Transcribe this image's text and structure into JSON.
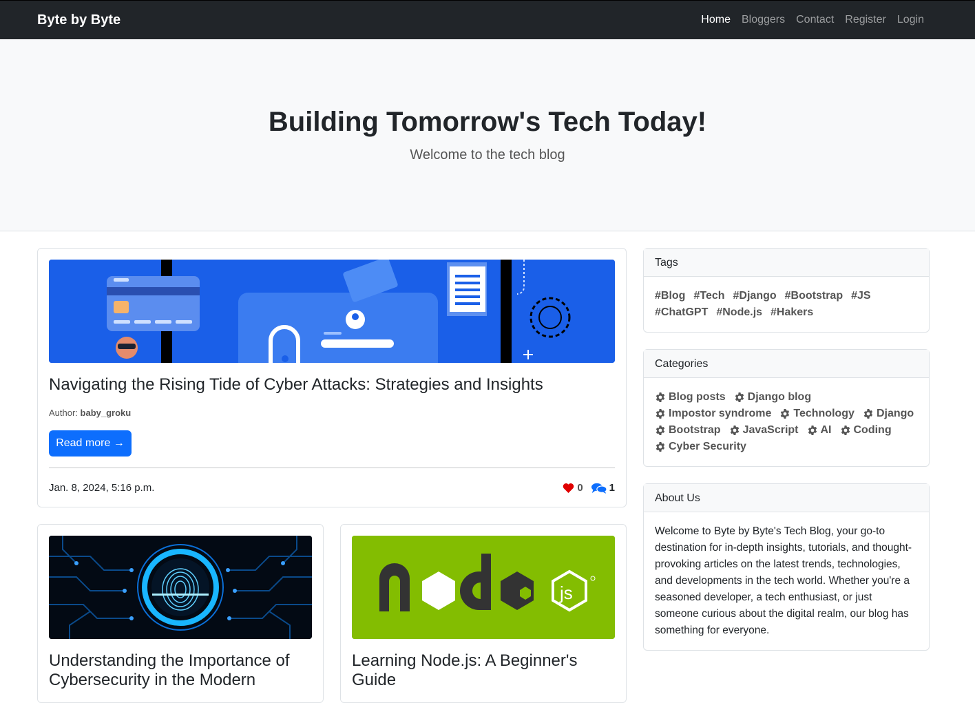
{
  "nav": {
    "brand": "Byte by Byte",
    "links": [
      "Home",
      "Bloggers",
      "Contact",
      "Register",
      "Login"
    ],
    "active": "Home"
  },
  "hero": {
    "title": "Building Tomorrow's Tech Today!",
    "subtitle": "Welcome to the tech blog"
  },
  "featured": {
    "title": "Navigating the Rising Tide of Cyber Attacks: Strategies and Insights",
    "author_label": "Author:",
    "author": "baby_groku",
    "read_more": "Read more →",
    "date": "Jan. 8, 2024, 5:16 p.m.",
    "likes": "0",
    "comments": "1"
  },
  "posts": [
    {
      "title": "Understanding the Importance of Cybersecurity in the Modern"
    },
    {
      "title": "Learning Node.js: A Beginner's Guide"
    }
  ],
  "tags": {
    "header": "Tags",
    "items": [
      "#Blog",
      "#Tech",
      "#Django",
      "#Bootstrap",
      "#JS",
      "#ChatGPT",
      "#Node.js",
      "#Hakers"
    ]
  },
  "categories": {
    "header": "Categories",
    "items": [
      "Blog posts",
      "Django blog",
      "Impostor syndrome",
      "Technology",
      "Django",
      "Bootstrap",
      "JavaScript",
      "AI",
      "Coding",
      "Cyber Security"
    ]
  },
  "about": {
    "header": "About Us",
    "text": "Welcome to Byte by Byte's Tech Blog, your go-to destination for in-depth insights, tutorials, and thought-provoking articles on the latest trends, technologies, and developments in the tech world. Whether you're a seasoned developer, a tech enthusiast, or just someone curious about the digital realm, our blog has something for everyone."
  },
  "colors": {
    "navbar": "#212529",
    "primary": "#0d6efd",
    "heart": "#e00000",
    "hero_bg": "#f8f9fa"
  },
  "icons": {
    "like": "heart-icon",
    "comments": "comments-icon",
    "category": "gear-icon"
  }
}
